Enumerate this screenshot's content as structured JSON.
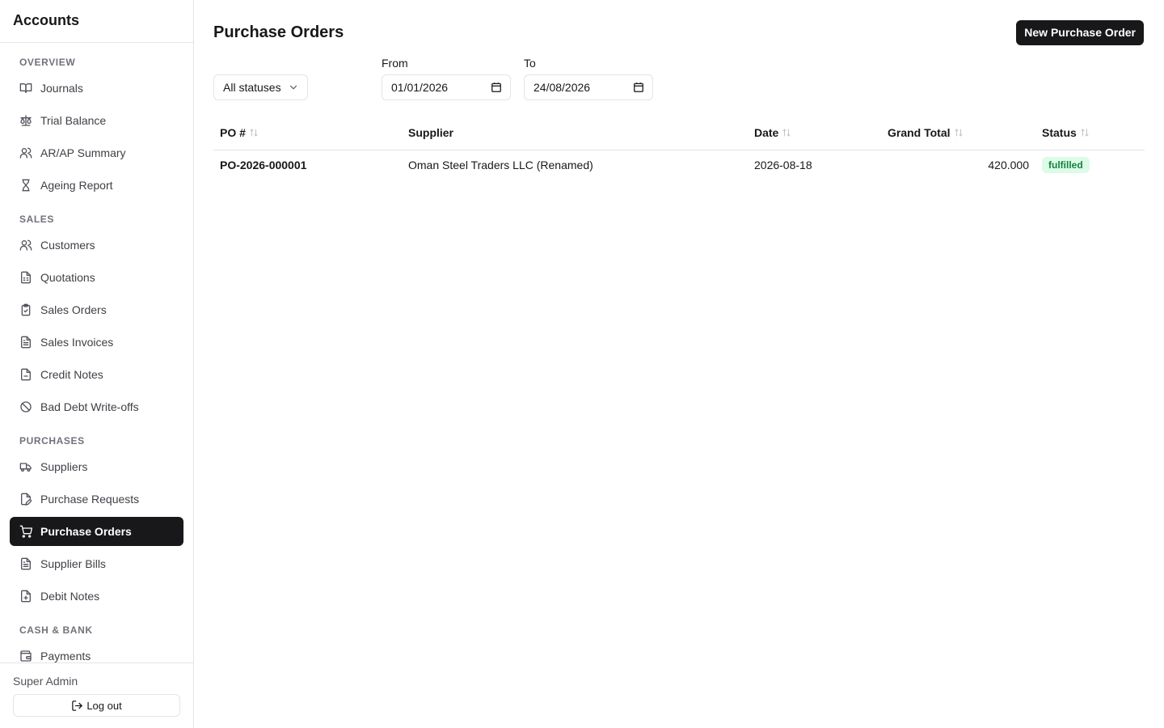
{
  "app": {
    "title": "Accounts"
  },
  "sidebar": {
    "sections": [
      {
        "label": "OVERVIEW",
        "items": [
          {
            "label": "Journals",
            "icon": "book-icon"
          },
          {
            "label": "Trial Balance",
            "icon": "scale-icon"
          },
          {
            "label": "AR/AP Summary",
            "icon": "users-icon"
          },
          {
            "label": "Ageing Report",
            "icon": "hourglass-icon"
          }
        ]
      },
      {
        "label": "SALES",
        "items": [
          {
            "label": "Customers",
            "icon": "users-icon"
          },
          {
            "label": "Quotations",
            "icon": "file-spreadsheet-icon"
          },
          {
            "label": "Sales Orders",
            "icon": "clipboard-check-icon"
          },
          {
            "label": "Sales Invoices",
            "icon": "file-text-icon"
          },
          {
            "label": "Credit Notes",
            "icon": "file-minus-icon"
          },
          {
            "label": "Bad Debt Write-offs",
            "icon": "ban-icon"
          }
        ]
      },
      {
        "label": "PURCHASES",
        "items": [
          {
            "label": "Suppliers",
            "icon": "truck-icon"
          },
          {
            "label": "Purchase Requests",
            "icon": "file-pen-icon"
          },
          {
            "label": "Purchase Orders",
            "icon": "cart-icon",
            "active": true
          },
          {
            "label": "Supplier Bills",
            "icon": "file-text-icon"
          },
          {
            "label": "Debit Notes",
            "icon": "file-plus-icon"
          }
        ]
      },
      {
        "label": "CASH & BANK",
        "items": [
          {
            "label": "Payments",
            "icon": "wallet-icon"
          }
        ]
      }
    ],
    "user": "Super Admin",
    "logout_label": "Log out"
  },
  "page": {
    "title": "Purchase Orders",
    "new_button": "New Purchase Order",
    "filters": {
      "status_selected": "All statuses",
      "from_label": "From",
      "from_value": "01/01/2026",
      "to_label": "To",
      "to_value": "24/08/2026"
    },
    "table": {
      "columns": [
        "PO #",
        "Supplier",
        "Date",
        "Grand Total",
        "Status"
      ],
      "rows": [
        {
          "po": "PO-2026-000001",
          "supplier": "Oman Steel Traders LLC (Renamed)",
          "date": "2026-08-18",
          "total": "420.000",
          "status": "fulfilled"
        }
      ]
    }
  },
  "colors": {
    "active_bg": "#18181b",
    "badge_bg": "#dcfce7",
    "badge_text": "#15803d",
    "border": "#e4e4e7"
  }
}
